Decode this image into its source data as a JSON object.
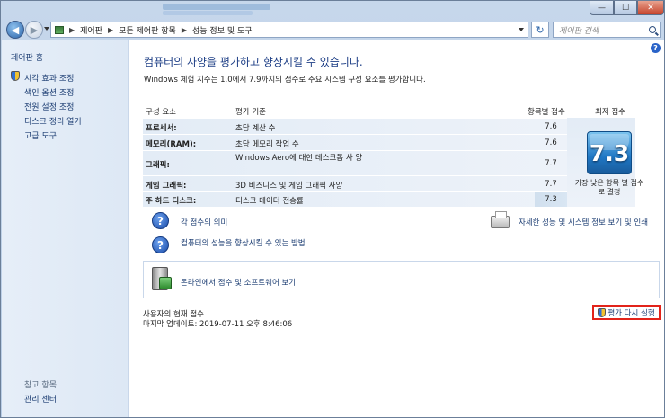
{
  "window": {
    "minimize": "—",
    "maximize": "☐",
    "close": "✕"
  },
  "nav": {
    "back": "◀",
    "forward": "▶",
    "breadcrumb": [
      "제어판",
      "모든 제어판 항목",
      "성능 정보 및 도구"
    ],
    "breadcrumb_sep": "▶",
    "refresh": "↻",
    "search_placeholder": "제어판 검색"
  },
  "sidebar": {
    "home": "제어판 홈",
    "items": [
      "시각 효과 조정",
      "색인 옵션 조정",
      "전원 설정 조정",
      "디스크 정리 열기",
      "고급 도구"
    ],
    "see_also": "참고 항목",
    "admin": "관리 센터"
  },
  "main": {
    "help": "?",
    "heading": "컴퓨터의 사양을 평가하고 향상시킬 수 있습니다.",
    "description": "Windows 체험 지수는 1.0에서 7.9까지의 점수로 주요 시스템 구성 요소를 평가합니다.",
    "table": {
      "headers": {
        "component": "구성 요소",
        "criteria": "평가 기준",
        "subscore": "항목별 점수",
        "base": "최저 점수"
      },
      "rows": [
        {
          "component": "프로세서:",
          "criteria": "초당 계산 수",
          "score": "7.6"
        },
        {
          "component": "메모리(RAM):",
          "criteria": "초당 메모리 작업 수",
          "score": "7.6"
        },
        {
          "component": "그래픽:",
          "criteria": "Windows Aero에 대한 데스크톱 사 양",
          "score": "7.7"
        },
        {
          "component": "게임 그래픽:",
          "criteria": "3D 비즈니스 및 게임 그래픽 사양",
          "score": "7.7"
        },
        {
          "component": "주 하드 디스크:",
          "criteria": "디스크 데이터 전송률",
          "score": "7.3"
        }
      ],
      "base_score": "7.3",
      "base_caption": "가장 낮은 항목 별 점수로 결정"
    },
    "links": {
      "meaning": "각 점수의 의미",
      "improve": "컴퓨터의 성능을 향상시킬 수 있는 방법",
      "print": "자세한 성능 및 시스템 정보 보기 및 인쇄",
      "online": "온라인에서 점수 및 소프트웨어 보기"
    },
    "footer": {
      "current": "사용자의 현재 점수",
      "updated": "마지막 업데이트: 2019-07-11 오후 8:46:06",
      "rerun": "평가 다시 실행"
    }
  }
}
